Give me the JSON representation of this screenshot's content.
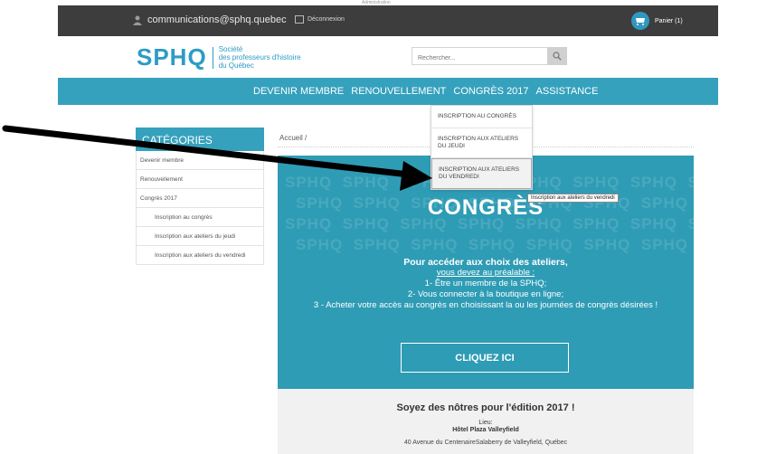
{
  "topbar": {
    "email": "communications@sphq.quebec",
    "logout": "Déconnexion",
    "cart": "Panier (1)",
    "faint_top": "Administration"
  },
  "logo": {
    "main": "SPHQ",
    "line1": "Société",
    "line2": "des professeurs d'histoire",
    "line3": "du Québec"
  },
  "search": {
    "placeholder": "Rechercher..."
  },
  "nav": {
    "items": [
      "DEVENIR MEMBRE",
      "RENOUVELLEMENT",
      "CONGRÈS 2017",
      "ASSISTANCE"
    ]
  },
  "dropdown": {
    "items": [
      "INSCRIPTION AU CONGRÈS",
      "INSCRIPTION AUX ATELIERS DU JEUDI",
      "INSCRIPTION AUX ATELIERS DU VENDREDI"
    ],
    "tooltip": "Inscription aux ateliers du vendredi"
  },
  "sidebar": {
    "title": "CATÉGORIES",
    "items": [
      "Devenir membre",
      "Renouvellement",
      "Congrès 2017"
    ],
    "subitems": [
      "Inscription au congrès",
      "Inscription aux ateliers du jeudi",
      "Inscription aux ateliers du vendredi"
    ]
  },
  "breadcrumb": {
    "home": "Accueil",
    "sep": "/"
  },
  "banner": {
    "pattern": "SPHQ",
    "title": "CONGRÈS",
    "line_intro": "Pour accéder aux choix des ateliers,",
    "line_pre": "vous devez au préalable :",
    "line1": "1- Être un membre de la SPHQ;",
    "line2": "2- Vous connecter à la boutique en ligne;",
    "line3": "3 - Acheter votre accès au congrès en choisissant la ou les journées de congrès désirées !",
    "cta": "CLIQUEZ ICI"
  },
  "info": {
    "heading": "Soyez des nôtres pour l'édition 2017 !",
    "lieu_label": "Lieu:",
    "venue": "Hôtel Plaza Valleyfield",
    "address": "40 Avenue du CentenaireSalaberry de Valleyfield, Québec"
  },
  "colors": {
    "accent": "#35a1bd",
    "topbar": "#3d3d3d",
    "banner": "#2f9cb5",
    "cart_badge": "#2f98c0"
  }
}
